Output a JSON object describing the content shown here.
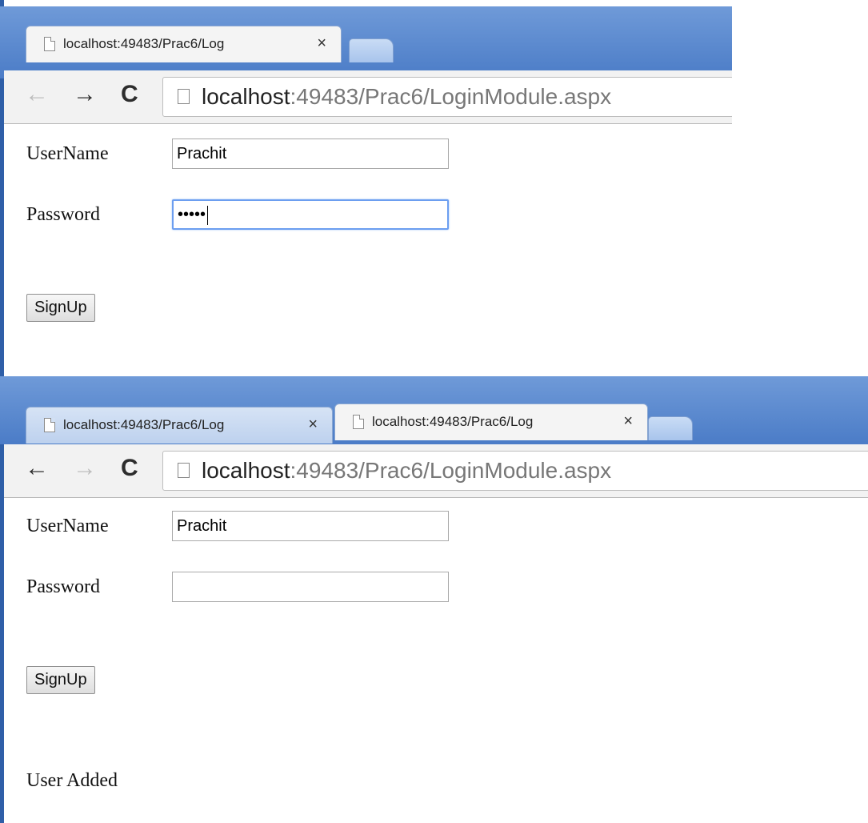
{
  "screenshot_1": {
    "tabs": [
      {
        "title": "localhost:49483/Prac6/Log",
        "close": "×",
        "active": true
      }
    ],
    "nav": {
      "back_icon": "←",
      "forward_icon": "→",
      "reload_icon": "C",
      "back_enabled": false,
      "forward_enabled": true
    },
    "address": {
      "host": "localhost",
      "rest": ":49483/Prac6/LoginModule.aspx"
    },
    "form": {
      "username_label": "UserName",
      "username_value": "Prachit",
      "password_label": "Password",
      "password_value": "•••••",
      "signup_label": "SignUp"
    }
  },
  "screenshot_2": {
    "tabs": [
      {
        "title": "localhost:49483/Prac6/Log",
        "close": "×",
        "active": false
      },
      {
        "title": "localhost:49483/Prac6/Log",
        "close": "×",
        "active": true
      }
    ],
    "nav": {
      "back_icon": "←",
      "forward_icon": "→",
      "reload_icon": "C",
      "back_enabled": true,
      "forward_enabled": false
    },
    "address": {
      "host": "localhost",
      "rest": ":49483/Prac6/LoginModule.aspx"
    },
    "form": {
      "username_label": "UserName",
      "username_value": "Prachit",
      "password_label": "Password",
      "password_value": "",
      "signup_label": "SignUp"
    },
    "message": "User Added"
  }
}
